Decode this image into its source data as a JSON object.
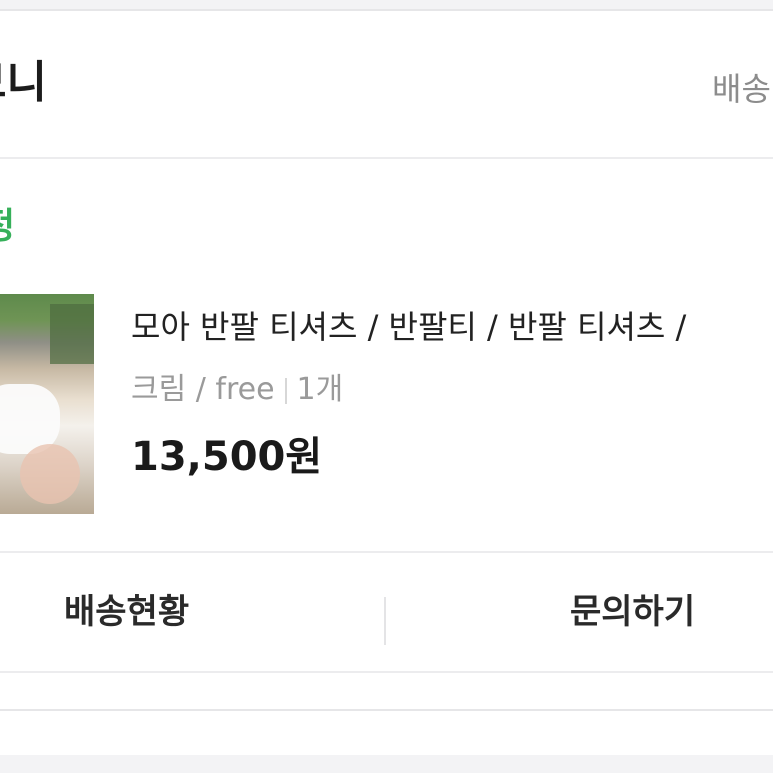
{
  "store": {
    "name": "모니",
    "shipping_link": "배송"
  },
  "order": {
    "status": "정"
  },
  "product": {
    "name": "모아 반팔 티셔츠 / 반팔티 / 반팔 티셔츠 /",
    "option": "크림 / free",
    "quantity": "1개",
    "price": "13,500원"
  },
  "actions": {
    "shipping_status": "배송현황",
    "inquiry": "문의하기"
  },
  "colors": {
    "status_green": "#36b05a",
    "text_dark": "#1a1a1a",
    "text_muted": "#9a9a9a"
  }
}
